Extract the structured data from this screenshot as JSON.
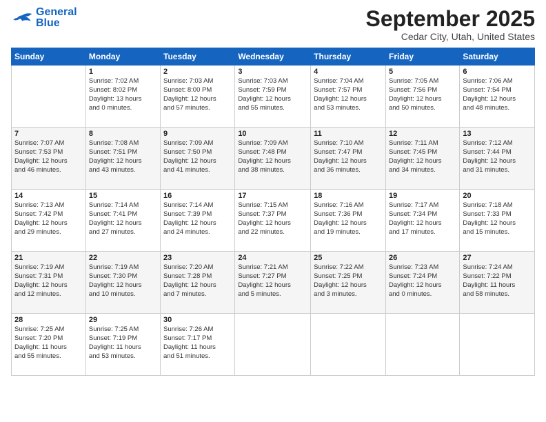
{
  "logo": {
    "line1": "General",
    "line2": "Blue"
  },
  "title": "September 2025",
  "location": "Cedar City, Utah, United States",
  "days_of_week": [
    "Sunday",
    "Monday",
    "Tuesday",
    "Wednesday",
    "Thursday",
    "Friday",
    "Saturday"
  ],
  "weeks": [
    [
      {
        "day": "",
        "info": ""
      },
      {
        "day": "1",
        "info": "Sunrise: 7:02 AM\nSunset: 8:02 PM\nDaylight: 13 hours\nand 0 minutes."
      },
      {
        "day": "2",
        "info": "Sunrise: 7:03 AM\nSunset: 8:00 PM\nDaylight: 12 hours\nand 57 minutes."
      },
      {
        "day": "3",
        "info": "Sunrise: 7:03 AM\nSunset: 7:59 PM\nDaylight: 12 hours\nand 55 minutes."
      },
      {
        "day": "4",
        "info": "Sunrise: 7:04 AM\nSunset: 7:57 PM\nDaylight: 12 hours\nand 53 minutes."
      },
      {
        "day": "5",
        "info": "Sunrise: 7:05 AM\nSunset: 7:56 PM\nDaylight: 12 hours\nand 50 minutes."
      },
      {
        "day": "6",
        "info": "Sunrise: 7:06 AM\nSunset: 7:54 PM\nDaylight: 12 hours\nand 48 minutes."
      }
    ],
    [
      {
        "day": "7",
        "info": "Sunrise: 7:07 AM\nSunset: 7:53 PM\nDaylight: 12 hours\nand 46 minutes."
      },
      {
        "day": "8",
        "info": "Sunrise: 7:08 AM\nSunset: 7:51 PM\nDaylight: 12 hours\nand 43 minutes."
      },
      {
        "day": "9",
        "info": "Sunrise: 7:09 AM\nSunset: 7:50 PM\nDaylight: 12 hours\nand 41 minutes."
      },
      {
        "day": "10",
        "info": "Sunrise: 7:09 AM\nSunset: 7:48 PM\nDaylight: 12 hours\nand 38 minutes."
      },
      {
        "day": "11",
        "info": "Sunrise: 7:10 AM\nSunset: 7:47 PM\nDaylight: 12 hours\nand 36 minutes."
      },
      {
        "day": "12",
        "info": "Sunrise: 7:11 AM\nSunset: 7:45 PM\nDaylight: 12 hours\nand 34 minutes."
      },
      {
        "day": "13",
        "info": "Sunrise: 7:12 AM\nSunset: 7:44 PM\nDaylight: 12 hours\nand 31 minutes."
      }
    ],
    [
      {
        "day": "14",
        "info": "Sunrise: 7:13 AM\nSunset: 7:42 PM\nDaylight: 12 hours\nand 29 minutes."
      },
      {
        "day": "15",
        "info": "Sunrise: 7:14 AM\nSunset: 7:41 PM\nDaylight: 12 hours\nand 27 minutes."
      },
      {
        "day": "16",
        "info": "Sunrise: 7:14 AM\nSunset: 7:39 PM\nDaylight: 12 hours\nand 24 minutes."
      },
      {
        "day": "17",
        "info": "Sunrise: 7:15 AM\nSunset: 7:37 PM\nDaylight: 12 hours\nand 22 minutes."
      },
      {
        "day": "18",
        "info": "Sunrise: 7:16 AM\nSunset: 7:36 PM\nDaylight: 12 hours\nand 19 minutes."
      },
      {
        "day": "19",
        "info": "Sunrise: 7:17 AM\nSunset: 7:34 PM\nDaylight: 12 hours\nand 17 minutes."
      },
      {
        "day": "20",
        "info": "Sunrise: 7:18 AM\nSunset: 7:33 PM\nDaylight: 12 hours\nand 15 minutes."
      }
    ],
    [
      {
        "day": "21",
        "info": "Sunrise: 7:19 AM\nSunset: 7:31 PM\nDaylight: 12 hours\nand 12 minutes."
      },
      {
        "day": "22",
        "info": "Sunrise: 7:19 AM\nSunset: 7:30 PM\nDaylight: 12 hours\nand 10 minutes."
      },
      {
        "day": "23",
        "info": "Sunrise: 7:20 AM\nSunset: 7:28 PM\nDaylight: 12 hours\nand 7 minutes."
      },
      {
        "day": "24",
        "info": "Sunrise: 7:21 AM\nSunset: 7:27 PM\nDaylight: 12 hours\nand 5 minutes."
      },
      {
        "day": "25",
        "info": "Sunrise: 7:22 AM\nSunset: 7:25 PM\nDaylight: 12 hours\nand 3 minutes."
      },
      {
        "day": "26",
        "info": "Sunrise: 7:23 AM\nSunset: 7:24 PM\nDaylight: 12 hours\nand 0 minutes."
      },
      {
        "day": "27",
        "info": "Sunrise: 7:24 AM\nSunset: 7:22 PM\nDaylight: 11 hours\nand 58 minutes."
      }
    ],
    [
      {
        "day": "28",
        "info": "Sunrise: 7:25 AM\nSunset: 7:20 PM\nDaylight: 11 hours\nand 55 minutes."
      },
      {
        "day": "29",
        "info": "Sunrise: 7:25 AM\nSunset: 7:19 PM\nDaylight: 11 hours\nand 53 minutes."
      },
      {
        "day": "30",
        "info": "Sunrise: 7:26 AM\nSunset: 7:17 PM\nDaylight: 11 hours\nand 51 minutes."
      },
      {
        "day": "",
        "info": ""
      },
      {
        "day": "",
        "info": ""
      },
      {
        "day": "",
        "info": ""
      },
      {
        "day": "",
        "info": ""
      }
    ]
  ]
}
